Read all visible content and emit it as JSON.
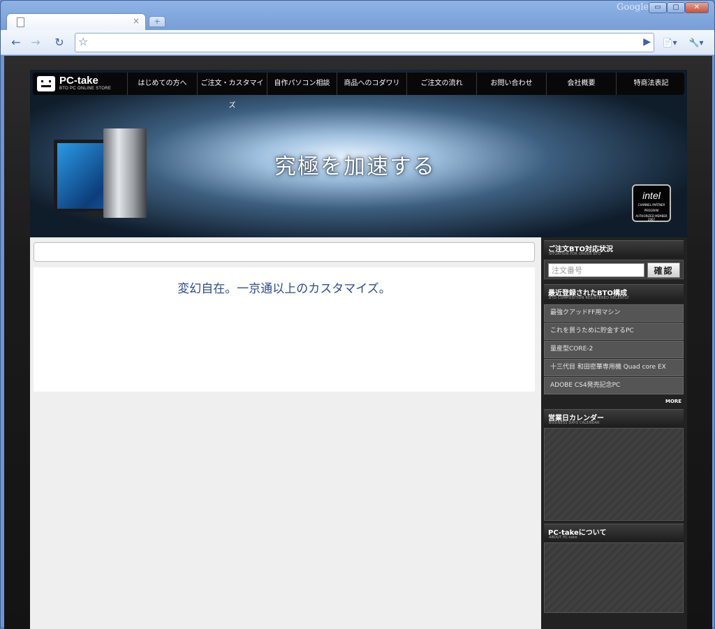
{
  "browser": {
    "brand": "Google",
    "tab_title": "",
    "tab_close": "×",
    "new_tab": "+",
    "window_buttons": {
      "minimize": "▭",
      "maximize": "▢",
      "close": "✕"
    },
    "address": "",
    "icons": {
      "back": "←",
      "forward": "→",
      "reload": "↻",
      "bookmark": "☆",
      "go": "▶",
      "page_menu": "📄▾",
      "tools_menu": "🔧▾"
    }
  },
  "site": {
    "logo": {
      "name": "PC-take",
      "sub": "BTO PC ONLINE STORE"
    },
    "nav": [
      "はじめての方へ",
      "ご注文・カスタマイズ",
      "自作パソコン相談",
      "商品へのコダワリ",
      "ご注文の流れ",
      "お問い合わせ",
      "会社概要",
      "特商法表記"
    ],
    "hero_tagline": "究極を加速する",
    "intel_badge": {
      "brand": "intel",
      "lines": [
        "CHANNEL PARTNER",
        "PROGRAM",
        "AUTHORIZED MEMBER 2007"
      ]
    },
    "intro_heading": "変幻自在。一京通以上のカスタマイズ。",
    "sidebar": {
      "order_status": {
        "title": "ご注文BTO対応状況",
        "subtitle": "SITUATION FOR ORDER BTO",
        "input_placeholder": "注文番号",
        "button": "確認"
      },
      "recent_bto": {
        "title": "最近登録されたBTO構成",
        "subtitle": "BTO COMPOSITION REGISTERED RECENTLY",
        "items": [
          "最強クアッドFF用マシン",
          "これを買うために貯金するPC",
          "量産型CORE-2",
          "十三代目 和田密華専用機 Quad core EX",
          "ADOBE CS4発売記念PC"
        ],
        "more": "MORE"
      },
      "calendar": {
        "title": "営業日カレンダー",
        "subtitle": "BUSINESS DAYS CALENDAR"
      },
      "about": {
        "title": "PC-takeについて",
        "subtitle": "ABOUT PC-take"
      }
    }
  }
}
